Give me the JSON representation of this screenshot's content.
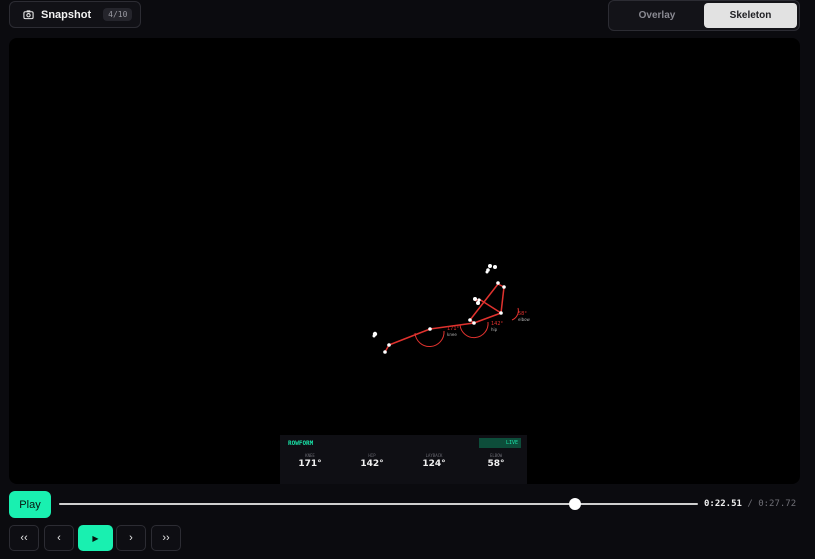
{
  "toolbar": {
    "snapshot_label": "Snapshot",
    "snapshot_count": "4/10",
    "modes": [
      "Overlay",
      "Skeleton"
    ],
    "active_mode": "Skeleton"
  },
  "skeleton_labels": {
    "knee": {
      "angle": "171°",
      "name": "knee"
    },
    "hip": {
      "angle": "142°",
      "name": "hip"
    },
    "elbow": {
      "angle": "58°",
      "name": "elbow"
    }
  },
  "stats_panel": {
    "brand": "ROWFORM",
    "badge": "LIVE",
    "metrics": [
      {
        "key": "KNEE",
        "value": "171°"
      },
      {
        "key": "HIP",
        "value": "142°"
      },
      {
        "key": "LAYBACK",
        "value": "124°"
      },
      {
        "key": "ELBOW",
        "value": "58°"
      }
    ]
  },
  "playback": {
    "play_label": "Play",
    "progress_fraction": 0.814,
    "current_time": "0:22.51",
    "separator": "/",
    "total_time": "0:27.72",
    "controls": [
      "‹‹",
      "‹",
      "▶",
      "›",
      "››"
    ]
  },
  "colors": {
    "accent": "#19f0b0",
    "skeleton": "#e0322e",
    "background": "#0b0b0f"
  }
}
